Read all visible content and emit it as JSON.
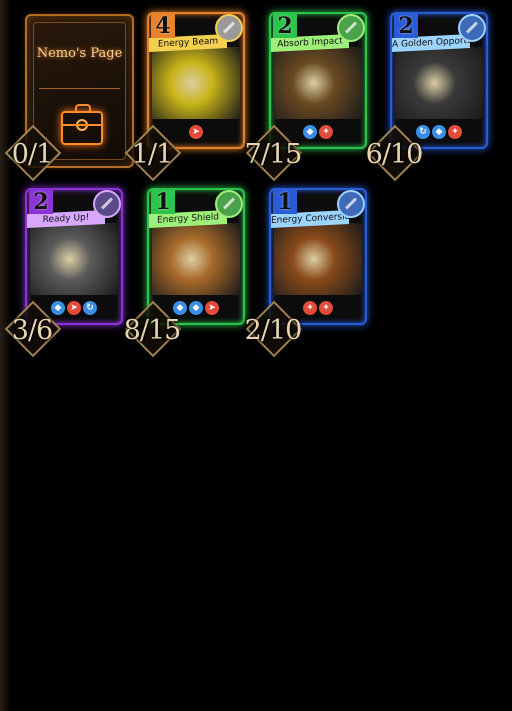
{
  "page_card": {
    "title": "Nemo's Page",
    "icon": "toolbox-icon",
    "counter": "0/1"
  },
  "cards": [
    {
      "name": "Energy Beam",
      "cost": "4",
      "rarity_color": "#e8822a",
      "banner_color": "#f4d050",
      "tag_color": "#9a9a9a",
      "art_color": "#c8b418",
      "keywords": [
        "attack"
      ],
      "counter": "1/1"
    },
    {
      "name": "Absorb Impact",
      "cost": "2",
      "rarity_color": "#2cc44c",
      "banner_color": "#9ef07a",
      "tag_color": "#4ca24a",
      "art_color": "#6a4a22",
      "keywords": [
        "shield",
        "fire"
      ],
      "counter": "7/15"
    },
    {
      "name": "A Golden Opportunity",
      "cost": "2",
      "rarity_color": "#2a5cd8",
      "banner_color": "#9ad4ff",
      "tag_color": "#3f6ab8",
      "art_color": "#3a3a3a",
      "keywords": [
        "cycle",
        "shield",
        "fire"
      ],
      "counter": "6/10"
    },
    {
      "name": "Ready Up!",
      "cost": "2",
      "rarity_color": "#8a34d8",
      "banner_color": "#d8a8ff",
      "tag_color": "#5a4a8a",
      "art_color": "#5a5a5a",
      "keywords": [
        "shield",
        "attack",
        "cycle"
      ],
      "counter": "3/6"
    },
    {
      "name": "Energy Shield",
      "cost": "1",
      "rarity_color": "#2cc44c",
      "banner_color": "#9ef07a",
      "tag_color": "#4ca24a",
      "art_color": "#a86a2a",
      "keywords": [
        "shield",
        "shield",
        "attack"
      ],
      "counter": "8/15"
    },
    {
      "name": "Energy Conversion",
      "cost": "1",
      "rarity_color": "#2a5cd8",
      "banner_color": "#9ad4ff",
      "tag_color": "#3f6ab8",
      "art_color": "#8a4a1a",
      "keywords": [
        "fire",
        "fire"
      ],
      "counter": "2/10"
    }
  ]
}
